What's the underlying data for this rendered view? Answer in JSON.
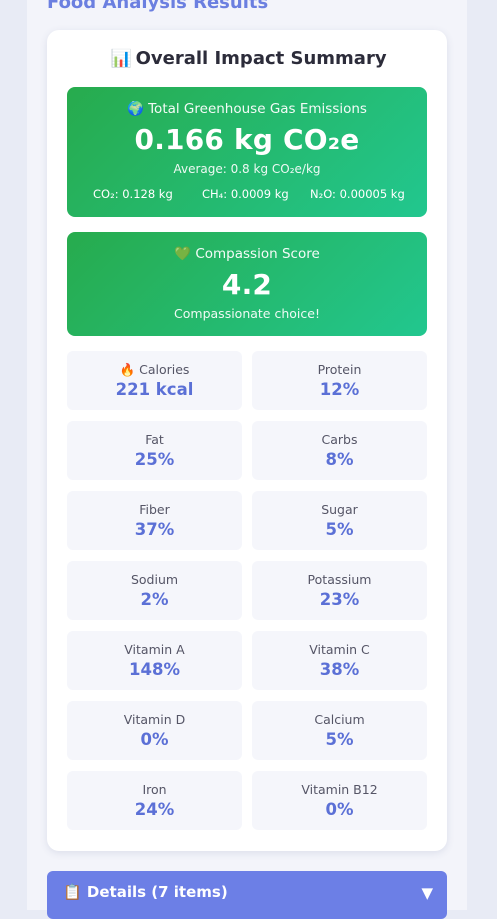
{
  "page": {
    "title": "Food Analysis Results"
  },
  "summary": {
    "icon": "📊",
    "icon_name": "bar-chart-icon",
    "heading": "Overall Impact Summary"
  },
  "ghg": {
    "icon": "🌍",
    "icon_name": "globe-icon",
    "label": "Total Greenhouse Gas Emissions",
    "value": "0.166 kg CO₂e",
    "average": "Average: 0.8 kg CO₂e/kg",
    "co2": "CO₂: 0.128 kg",
    "ch4": "CH₄: 0.0009 kg",
    "n2o": "N₂O: 0.00005 kg",
    "gradient_start": "#27ab4d",
    "gradient_end": "#22c78f"
  },
  "compassion": {
    "icon": "💚",
    "icon_name": "green-heart-icon",
    "label": "Compassion Score",
    "score": "4.2",
    "message": "Compassionate choice!"
  },
  "nutrients": [
    {
      "label": "Calories",
      "value": "221 kcal",
      "icon": "🔥",
      "icon_name": "fire-icon"
    },
    {
      "label": "Protein",
      "value": "12%"
    },
    {
      "label": "Fat",
      "value": "25%"
    },
    {
      "label": "Carbs",
      "value": "8%"
    },
    {
      "label": "Fiber",
      "value": "37%"
    },
    {
      "label": "Sugar",
      "value": "5%"
    },
    {
      "label": "Sodium",
      "value": "2%"
    },
    {
      "label": "Potassium",
      "value": "23%"
    },
    {
      "label": "Vitamin A",
      "value": "148%"
    },
    {
      "label": "Vitamin C",
      "value": "38%"
    },
    {
      "label": "Vitamin D",
      "value": "0%"
    },
    {
      "label": "Calcium",
      "value": "5%"
    },
    {
      "label": "Iron",
      "value": "24%"
    },
    {
      "label": "Vitamin B12",
      "value": "0%"
    }
  ],
  "details": {
    "icon": "📋",
    "icon_name": "clipboard-icon",
    "title": "Details (7 items)",
    "chevron": "▼"
  },
  "colors": {
    "accent": "#6b7fe0",
    "value_text": "#5b70d6",
    "details_bar": "#6c7fe6"
  }
}
